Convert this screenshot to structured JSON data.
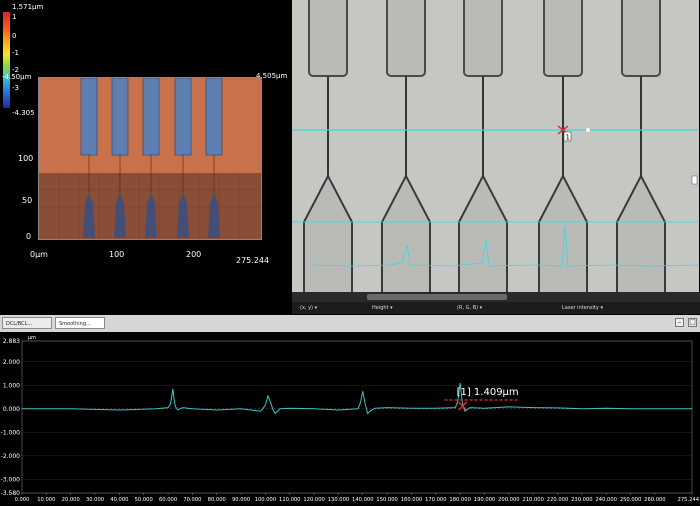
{
  "view3d": {
    "colorbar": {
      "max_label": "1.571µm",
      "labels": [
        "1",
        "0",
        "-1",
        "-2",
        "-3"
      ],
      "min_label": "-4.305",
      "mid_label": "-4.50µm"
    },
    "corner_label_right": "4.505µm",
    "y_ticks": [
      "100",
      "50",
      "0"
    ],
    "x_ticks": [
      "0µm",
      "100",
      "200"
    ],
    "x_end": "275.244",
    "colors": {
      "surface_top": "#c8714a",
      "surface_bottom": "#8a4e37",
      "bars": "#5e7fb0"
    }
  },
  "status_bar": {
    "items": [
      "(x, y)  ▾",
      "Height  ▾",
      "(R, G, B)  ▾",
      "Laser intensity  ▾"
    ]
  },
  "tabs": [
    {
      "label": "DCL/BCL..."
    },
    {
      "label": "Smoothing..."
    }
  ],
  "window_buttons": [
    "–",
    "□"
  ],
  "profile": {
    "unit_label": "µm",
    "measurement_label": "[1] 1.409µm",
    "line_color": "#3fc4c4",
    "cursor_color": "#e83030"
  },
  "optical": {
    "marker_label": "1",
    "line_color": "#39d6e6"
  },
  "chart_data": {
    "type": "line",
    "title": "",
    "xlabel": "",
    "ylabel": "µm",
    "xlim": [
      0,
      275.244
    ],
    "ylim": [
      -3.58,
      2.883
    ],
    "y_ticks": [
      "2.883",
      "2.000",
      "1.000",
      "0.000",
      "-1.000",
      "-2.000",
      "-3.000",
      "-3.580"
    ],
    "y_tick_values": [
      2.883,
      2.0,
      1.0,
      0.0,
      -1.0,
      -2.0,
      -3.0,
      -3.58
    ],
    "x_ticks": [
      "0.000",
      "10.000",
      "20.000",
      "30.000",
      "40.000",
      "50.000",
      "60.000",
      "70.000",
      "80.000",
      "90.000",
      "100.000",
      "110.000",
      "120.000",
      "130.000",
      "140.000",
      "150.000",
      "160.000",
      "170.000",
      "180.000",
      "190.000",
      "200.000",
      "210.000",
      "220.000",
      "230.000",
      "240.000",
      "250.000",
      "260.000",
      "275.244"
    ],
    "x_tick_values": [
      0,
      10,
      20,
      30,
      40,
      50,
      60,
      70,
      80,
      90,
      100,
      110,
      120,
      130,
      140,
      150,
      160,
      170,
      180,
      190,
      200,
      210,
      220,
      230,
      240,
      250,
      260,
      275.244
    ],
    "series": [
      {
        "x": [
          0,
          20,
          40,
          55,
          60,
          61,
          62,
          62.5,
          63,
          64,
          66,
          70,
          80,
          90,
          98,
          100,
          101,
          102,
          103,
          104,
          106,
          110,
          120,
          130,
          138,
          139,
          140,
          141,
          142,
          143,
          145,
          150,
          160,
          170,
          178,
          179,
          180,
          180.5,
          181,
          182,
          184,
          190,
          200,
          210,
          220,
          230,
          240,
          250,
          260,
          270,
          275.244
        ],
        "y": [
          0.0,
          0.0,
          -0.05,
          0.0,
          0.05,
          0.2,
          0.85,
          0.4,
          0.1,
          -0.05,
          0.05,
          0.0,
          -0.05,
          0.0,
          -0.1,
          0.15,
          0.55,
          0.3,
          0.0,
          -0.2,
          0.0,
          0.02,
          0.0,
          -0.05,
          0.0,
          0.25,
          0.75,
          0.2,
          -0.2,
          -0.1,
          0.02,
          0.05,
          0.02,
          0.02,
          0.05,
          0.3,
          1.1,
          0.6,
          0.2,
          -0.1,
          0.05,
          0.02,
          0.08,
          0.05,
          0.04,
          0.0,
          0.02,
          0.0,
          0.0,
          0.0,
          0.0
        ]
      }
    ],
    "cursor_x": 181,
    "cursor_y": 0.12
  }
}
